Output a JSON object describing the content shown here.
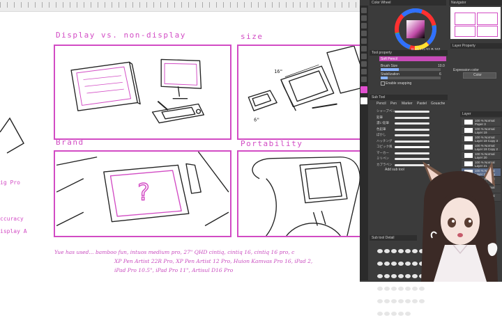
{
  "canvas": {
    "labels": {
      "display": "Display vs. non-display",
      "size": "size",
      "brand": "Brand",
      "portability": "Portability"
    },
    "margin_notes": [
      "ig Pro",
      "ccuracy",
      "isplay A"
    ],
    "bottom_notes": {
      "line1": "Yue has used... bamboo fun, intuos medium pro, 27\" QHD cintiq, cintiq 16, cintiq 16 pro, c",
      "line2": "XP Pen Artist 22R Pro, XP Pen Artist 12 Pro, Huion Kamvas Pro 16, iPad 2,",
      "line3": "iPad Pro 10.5\", iPad Pro 11\", Artisul D16 Pro"
    },
    "sketch_labels": {
      "size_top": "16\"",
      "size_bottom": "6\""
    }
  },
  "ui": {
    "color_panel_title": "Color Wheel",
    "navigator_title": "Navigator",
    "color_readout": "R 23 1 G 51 B 162",
    "tool_property_title": "Tool property",
    "brush_name": "Soft Pencil",
    "brush_size_label": "Brush Size",
    "brush_size_value": "10.0",
    "stabilization_label": "Stabilization",
    "stabilization_value": "6",
    "snapping_label": "Enable snapping",
    "layer_property_title": "Layer Property",
    "expression_color_label": "Expression color",
    "expression_color_value": "Color",
    "subtool_title": "Sub Tool",
    "subtool_tabs": [
      "Pencil",
      "Pen",
      "Marker",
      "Pastel",
      "Gouache"
    ],
    "brushes": [
      "シャープペン",
      "鉛筆",
      "濃い鉛筆",
      "色鉛筆",
      "ぼかし",
      "ハッチング",
      "コピック風",
      "マーカー",
      "ミリペン",
      "カブラペン"
    ],
    "add_subtool": "Add sub tool",
    "layers_title": "Layer",
    "layers": [
      {
        "mode": "100 % Normal",
        "name": "Paper 3"
      },
      {
        "mode": "100 % Normal",
        "name": "Layer 19"
      },
      {
        "mode": "100 % Normal",
        "name": "Layer 19 Copy 3"
      },
      {
        "mode": "100 % Normal",
        "name": "Layer 19 Copy 2"
      },
      {
        "mode": "100 % Normal",
        "name": "Layer 20"
      },
      {
        "mode": "100 % Normal",
        "name": "Layer 21"
      },
      {
        "mode": "100 % Normal",
        "name": "Layer 19 Copy"
      },
      {
        "mode": "100 % Normal",
        "name": "Layer 12"
      },
      {
        "mode": "100 % Normal",
        "name": "Layer 17"
      },
      {
        "mode": "100 % Normal",
        "name": "Paper"
      }
    ],
    "material_title": "Sub tool Detail",
    "accent": "#e24fd0"
  },
  "colors": {
    "ink": "#d24bc4",
    "ui_bg": "#3b3b3b"
  }
}
